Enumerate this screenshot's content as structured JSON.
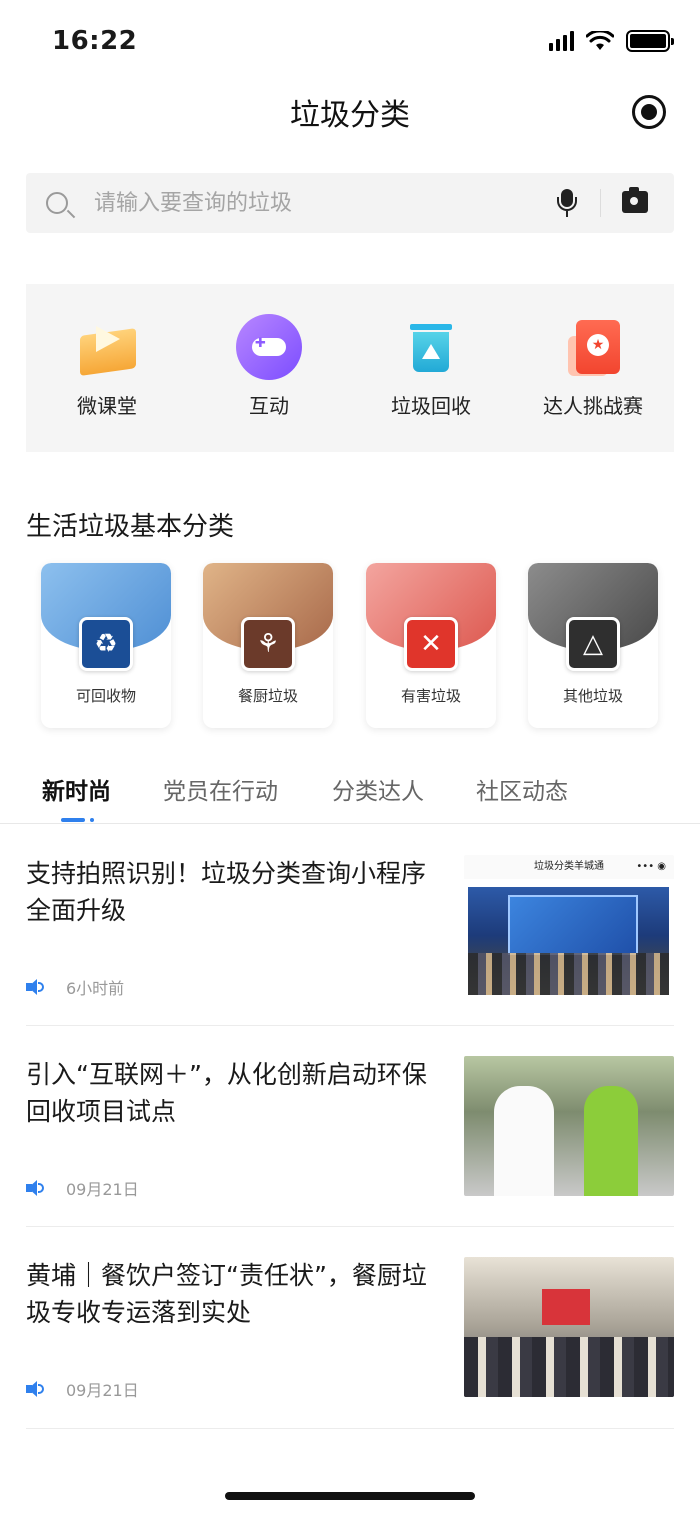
{
  "status_bar": {
    "time": "16:22"
  },
  "nav": {
    "title": "垃圾分类"
  },
  "search": {
    "placeholder": "请输入要查询的垃圾"
  },
  "quick_menu": [
    {
      "label": "微课堂",
      "icon": "course-icon"
    },
    {
      "label": "互动",
      "icon": "gamepad-icon"
    },
    {
      "label": "垃圾回收",
      "icon": "recycle-bin-icon"
    },
    {
      "label": "达人挑战赛",
      "icon": "medal-icon"
    }
  ],
  "categories": {
    "title": "生活垃圾基本分类",
    "items": [
      {
        "label": "可回收物",
        "icon": "recyclable-icon",
        "color": "#1b4e96",
        "header": "#6aa7e2"
      },
      {
        "label": "餐厨垃圾",
        "icon": "food-waste-icon",
        "color": "#6b3a2a",
        "header": "#c08a63"
      },
      {
        "label": "有害垃圾",
        "icon": "hazardous-icon",
        "color": "#e0352b",
        "header": "#ea7a72"
      },
      {
        "label": "其他垃圾",
        "icon": "other-waste-icon",
        "color": "#2f2f2f",
        "header": "#6c6c6c"
      }
    ]
  },
  "tabs": [
    "新时尚",
    "党员在行动",
    "分类达人",
    "社区动态"
  ],
  "news": [
    {
      "title": "支持拍照识别！垃圾分类查询小程序全面升级",
      "time": "6小时前",
      "thumb_header": "垃圾分类羊城通"
    },
    {
      "title": "引入“互联网＋”，从化创新启动环保回收项目试点",
      "time": "09月21日"
    },
    {
      "title": "黄埔｜餐饮户签订“责任状”，餐厨垃圾专收专运落到实处",
      "time": "09月21日"
    }
  ],
  "colors": {
    "accent": "#2f80ed",
    "search_bg": "#f3f3f3",
    "quick_bg": "#f5f5f5"
  }
}
